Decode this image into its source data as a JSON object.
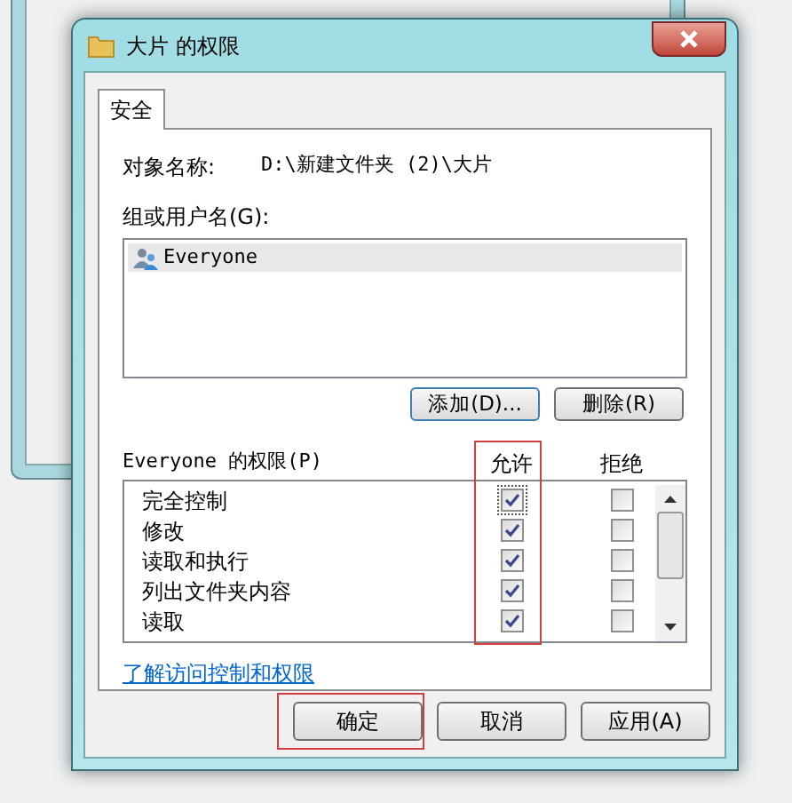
{
  "window": {
    "title": "大片 的权限"
  },
  "tabs": [
    {
      "label": "安全",
      "selected": true
    }
  ],
  "object_name": {
    "label": "对象名称:",
    "value": "D:\\新建文件夹 (2)\\大片"
  },
  "groups": {
    "label": "组或用户名(G):",
    "items": [
      {
        "name": "Everyone",
        "selected": true
      }
    ]
  },
  "group_buttons": [
    "添加(D)...",
    "删除(R)"
  ],
  "permissions": {
    "label": "Everyone 的权限(P)",
    "allow_header": "允许",
    "deny_header": "拒绝",
    "allow_highlighted": true,
    "rows": [
      {
        "name": "完全控制",
        "allow": true,
        "deny": false
      },
      {
        "name": "修改",
        "allow": true,
        "deny": false
      },
      {
        "name": "读取和执行",
        "allow": true,
        "deny": false
      },
      {
        "name": "列出文件夹内容",
        "allow": true,
        "deny": false
      },
      {
        "name": "读取",
        "allow": true,
        "deny": false
      }
    ]
  },
  "link": "了解访问控制和权限",
  "buttons": [
    {
      "label": "确定",
      "highlighted": true
    },
    {
      "label": "取消",
      "highlighted": false
    },
    {
      "label": "应用(A)",
      "highlighted": false
    }
  ]
}
